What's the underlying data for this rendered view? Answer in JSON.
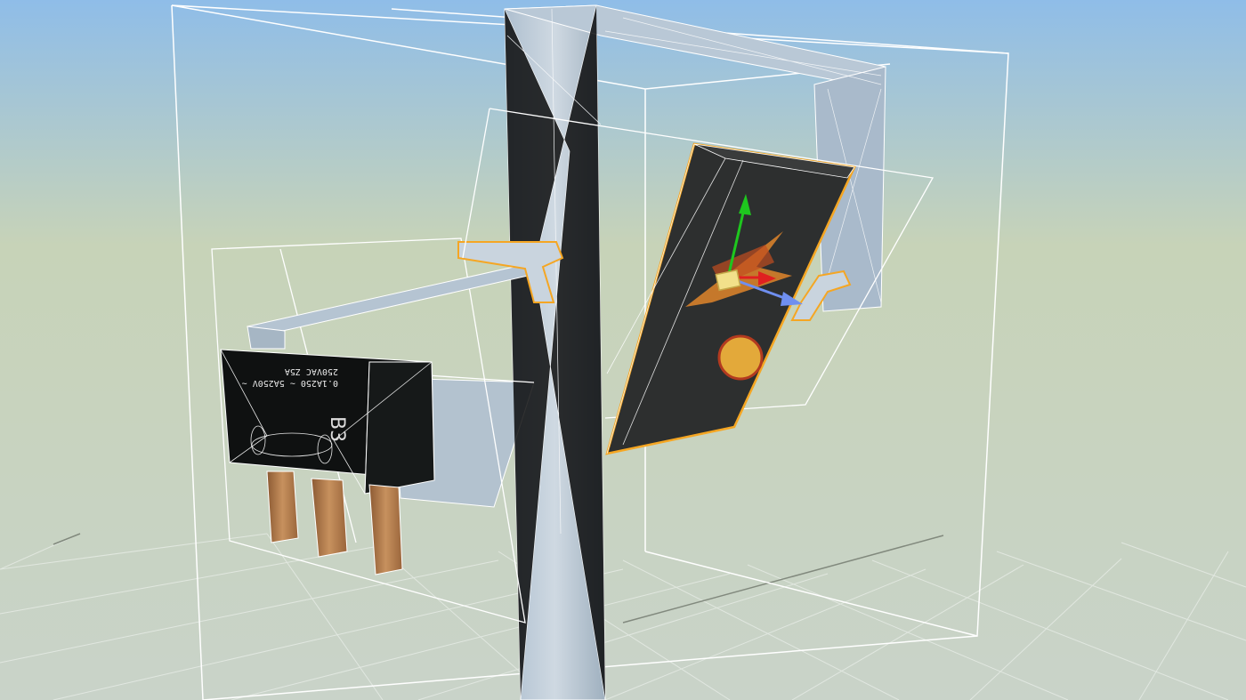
{
  "viewport": {
    "background_top": "#8fbde8",
    "background_mid": "#c7d3b8",
    "background_bottom": "#c9d3c9",
    "grid_color": "#eef2ee",
    "bounding_box_color": "#ffffff",
    "selection_color": "#f5a623"
  },
  "switch_body": {
    "color": "#0f1111",
    "text_line_1": "0.1A250 ~ 5A250V ~",
    "text_line_2": "250VAC Z5A",
    "model_mark": "B3",
    "pin_color": "#b57b4a"
  },
  "label_plate": {
    "color": "#2d2f2f",
    "emblem_color": "#e0852a",
    "dot_color": "#e3a93a",
    "dot_rim_color": "#b33a1f"
  },
  "gizmo": {
    "y_axis_color": "#1ec71e",
    "x_axis_color": "#e02020",
    "z_axis_color": "#6f8ff0",
    "center_color": "#f2e08a"
  }
}
